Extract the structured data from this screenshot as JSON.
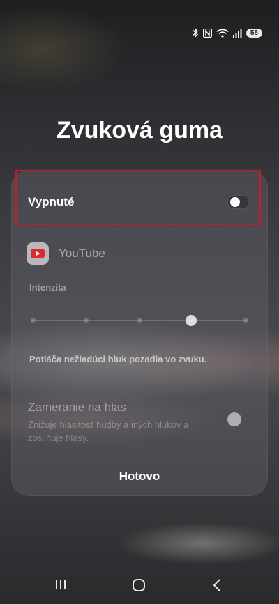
{
  "status_bar": {
    "battery": "58",
    "icons": [
      "bluetooth-icon",
      "nfc-icon",
      "wifi-icon",
      "signal-icon",
      "battery-icon"
    ]
  },
  "title": "Zvuková guma",
  "main_toggle": {
    "label": "Vypnuté",
    "state": "off"
  },
  "app": {
    "name": "YouTube",
    "icon": "youtube-icon"
  },
  "intensity": {
    "label": "Intenzita",
    "level": 3,
    "max": 4
  },
  "description": "Potláča nežiadúci hluk pozadia vo zvuku.",
  "voice_focus": {
    "title": "Zameranie na hlas",
    "subtitle": "Znižuje hlasitosť hudby a iných hlukov a zosilňuje hlasy.",
    "state": "off"
  },
  "done_label": "Hotovo",
  "nav": {
    "recent": "recent-apps-icon",
    "home": "home-icon",
    "back": "back-icon"
  },
  "colors": {
    "highlight": "#d0182b",
    "youtube_red": "#e0262f"
  }
}
